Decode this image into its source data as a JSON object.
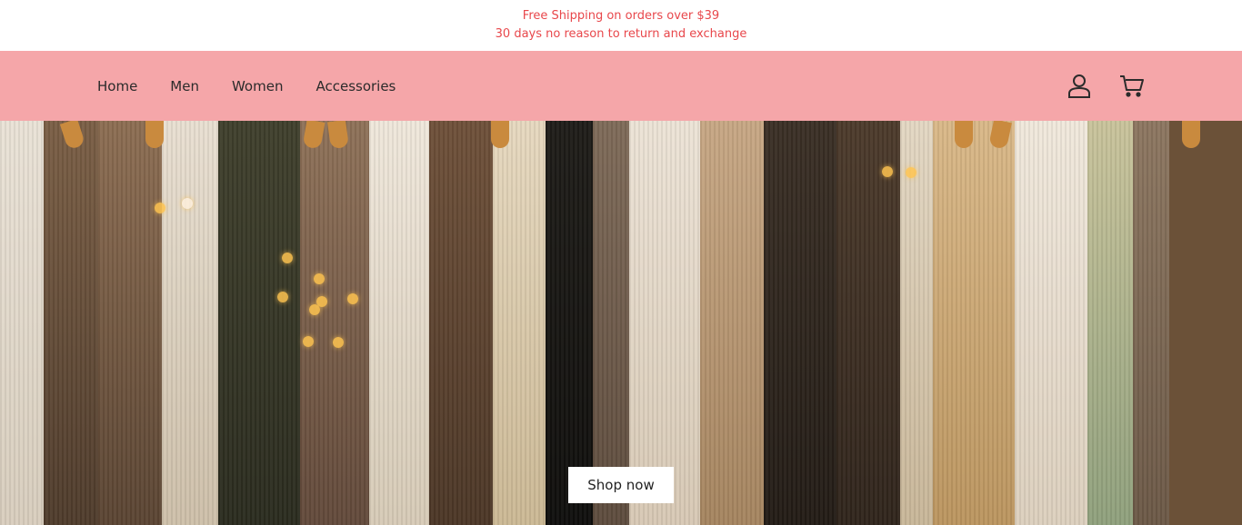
{
  "announcement": {
    "line1": "Free Shipping on orders over $39",
    "line2": "30 days no reason to return and exchange",
    "color": "#e8474b"
  },
  "header": {
    "background": "#f5a6a9",
    "nav": [
      {
        "label": "Home"
      },
      {
        "label": "Men"
      },
      {
        "label": "Women"
      },
      {
        "label": "Accessories"
      }
    ],
    "icons": [
      "user-icon",
      "cart-icon"
    ]
  },
  "hero": {
    "image_description_icon": "clothing-rack-image",
    "cta_label": "Shop now"
  }
}
